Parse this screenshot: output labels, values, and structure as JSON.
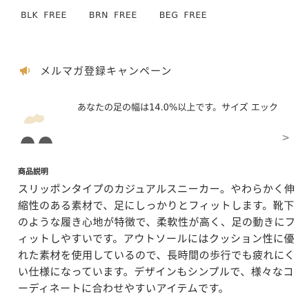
{
  "tags": [
    {
      "a": "BLK",
      "b": "FREE"
    },
    {
      "a": "BRN",
      "b": "FREE"
    },
    {
      "a": "BEG",
      "b": "FREE"
    }
  ],
  "notice": {
    "title": "メルマガ登録キャンペーン",
    "icon": "megaphone-icon"
  },
  "user_card": {
    "text": "あなたの足の幅は14.0%以上です。サイズ エック",
    "chevron": ">"
  },
  "section": {
    "title": "商品説明"
  },
  "body": {
    "text": "スリッポンタイプのカジュアルスニーカー。やわらかく伸縮性のある素材で、足にしっかりとフィットします。靴下のような履き心地が特徴で、柔軟性が高く、足の動きにフィットしやすいです。アウトソールにはクッション性に優れた素材を使用しているので、長時間の歩行でも疲れにくい仕様になっています。デザインもシンプルで、様々なコーディネートに合わせやすいアイテムです。"
  },
  "colors": {
    "text": "#2b2b2b",
    "accent": "#d9a24a"
  }
}
